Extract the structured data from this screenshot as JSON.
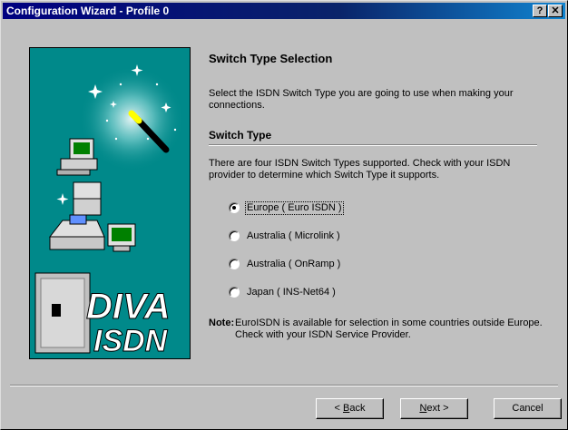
{
  "window": {
    "title": "Configuration Wizard - Profile 0",
    "help_button": "?",
    "close_button": "✕"
  },
  "page": {
    "heading": "Switch Type Selection",
    "intro": "Select the ISDN Switch Type you are going to use when making your connections.",
    "section_title": "Switch Type",
    "description": "There are four ISDN Switch Types supported. Check with your ISDN provider to determine which Switch Type it supports.",
    "options": [
      {
        "label": "Europe ( Euro ISDN )",
        "selected": true
      },
      {
        "label": "Australia ( Microlink )",
        "selected": false
      },
      {
        "label": "Australia ( OnRamp )",
        "selected": false
      },
      {
        "label": "Japan ( INS-Net64 )",
        "selected": false
      }
    ],
    "note_label": "Note:",
    "note_text": "EuroISDN is available for selection in some countries outside Europe. Check with your ISDN Service Provider."
  },
  "brand": {
    "line1": "DIVA",
    "line2": "ISDN"
  },
  "buttons": {
    "back_mnemonic": "B",
    "back_rest": "ack",
    "back_prefix": "< ",
    "next_mnemonic": "N",
    "next_rest": "ext",
    "next_suffix": " >",
    "cancel": "Cancel"
  },
  "colors": {
    "art_background": "#00898a",
    "title_bar": "#000080"
  }
}
